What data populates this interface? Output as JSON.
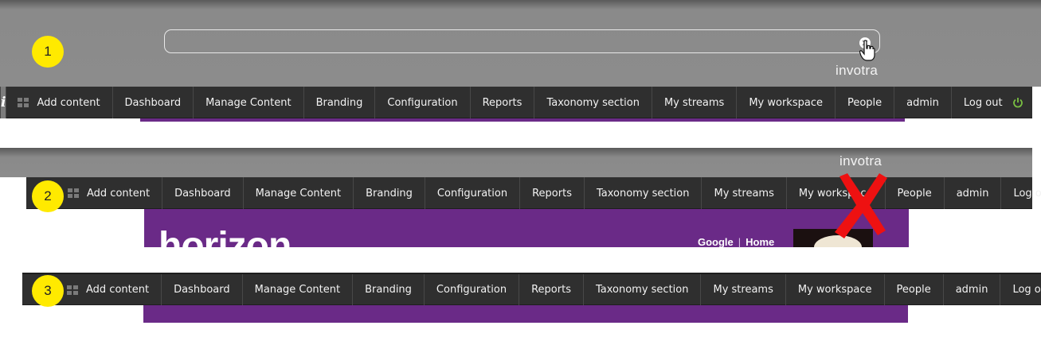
{
  "steps": {
    "one": "1",
    "two": "2",
    "three": "3"
  },
  "brand": {
    "name": "invotra"
  },
  "search": {
    "value": ""
  },
  "toolbar": {
    "info_label": "i",
    "items": [
      "Add content",
      "Dashboard",
      "Manage Content",
      "Branding",
      "Configuration",
      "Reports",
      "Taxonomy section",
      "My streams",
      "My workspace",
      "People",
      "admin",
      "Log out"
    ]
  },
  "site": {
    "logo_text": "horizon",
    "links": [
      "Google",
      "Home"
    ]
  },
  "colors": {
    "toolbar": "#2f2f2f",
    "header_grey": "#8c8c8c",
    "site_purple": "#6a2a87",
    "badge": "#ffea00",
    "power": "#7ac142",
    "strike": "#ee1111"
  },
  "icons": [
    "info-icon",
    "grid-icon",
    "power-icon",
    "pointer-cursor-icon",
    "red-x-icon",
    "close-icon"
  ]
}
